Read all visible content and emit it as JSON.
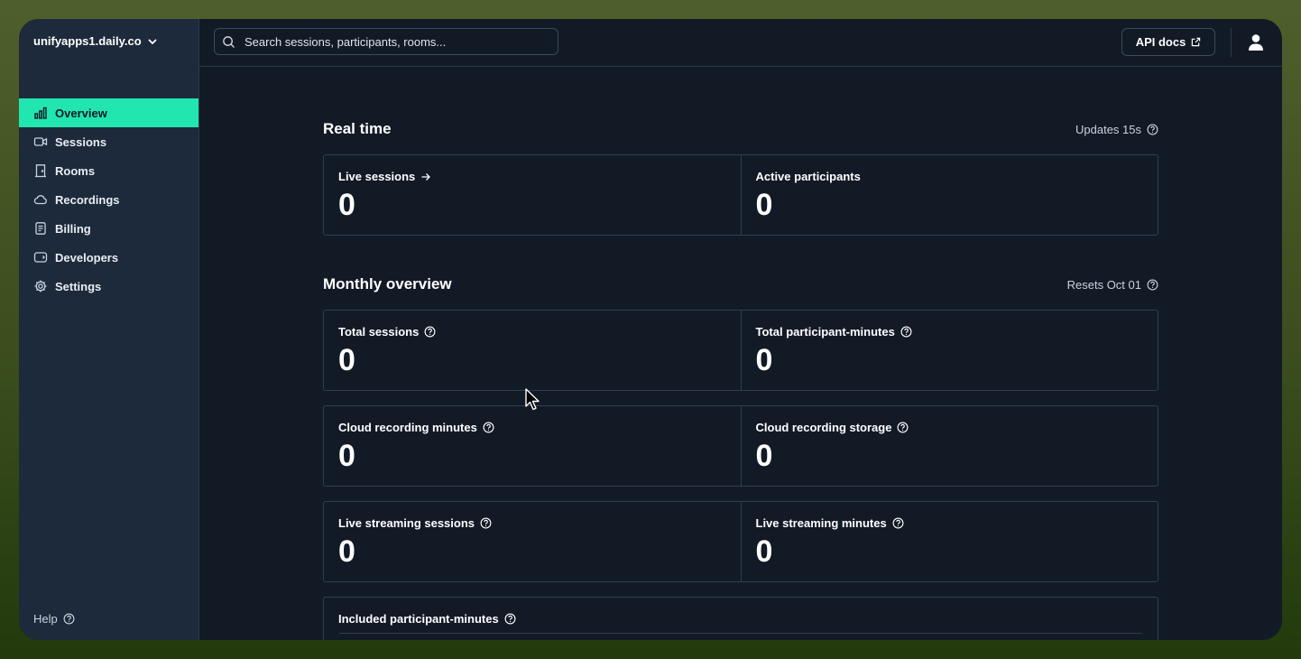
{
  "workspace": {
    "domain": "unifyapps1.daily.co"
  },
  "sidebar": {
    "items": [
      {
        "label": "Overview",
        "icon": "bar-chart-icon",
        "active": true
      },
      {
        "label": "Sessions",
        "icon": "video-camera-icon",
        "active": false
      },
      {
        "label": "Rooms",
        "icon": "door-icon",
        "active": false
      },
      {
        "label": "Recordings",
        "icon": "cloud-icon",
        "active": false
      },
      {
        "label": "Billing",
        "icon": "receipt-icon",
        "active": false
      },
      {
        "label": "Developers",
        "icon": "code-block-icon",
        "active": false
      },
      {
        "label": "Settings",
        "icon": "gear-icon",
        "active": false
      }
    ],
    "help_label": "Help"
  },
  "topbar": {
    "search_placeholder": "Search sessions, participants, rooms...",
    "api_docs_label": "API docs"
  },
  "realtime": {
    "title": "Real time",
    "note": "Updates 15s",
    "cards": [
      {
        "label": "Live sessions",
        "value": "0"
      },
      {
        "label": "Active participants",
        "value": "0"
      }
    ]
  },
  "monthly": {
    "title": "Monthly overview",
    "note": "Resets Oct 01",
    "rows": [
      [
        {
          "label": "Total sessions",
          "value": "0"
        },
        {
          "label": "Total participant-minutes",
          "value": "0"
        }
      ],
      [
        {
          "label": "Cloud recording minutes",
          "value": "0"
        },
        {
          "label": "Cloud recording storage",
          "value": "0"
        }
      ],
      [
        {
          "label": "Live streaming sessions",
          "value": "0"
        },
        {
          "label": "Live streaming minutes",
          "value": "0"
        }
      ]
    ],
    "included_label": "Included participant-minutes"
  },
  "colors": {
    "accent": "#22e6b0",
    "sidebar_bg": "#1d2a3b",
    "main_bg": "#121a26"
  }
}
